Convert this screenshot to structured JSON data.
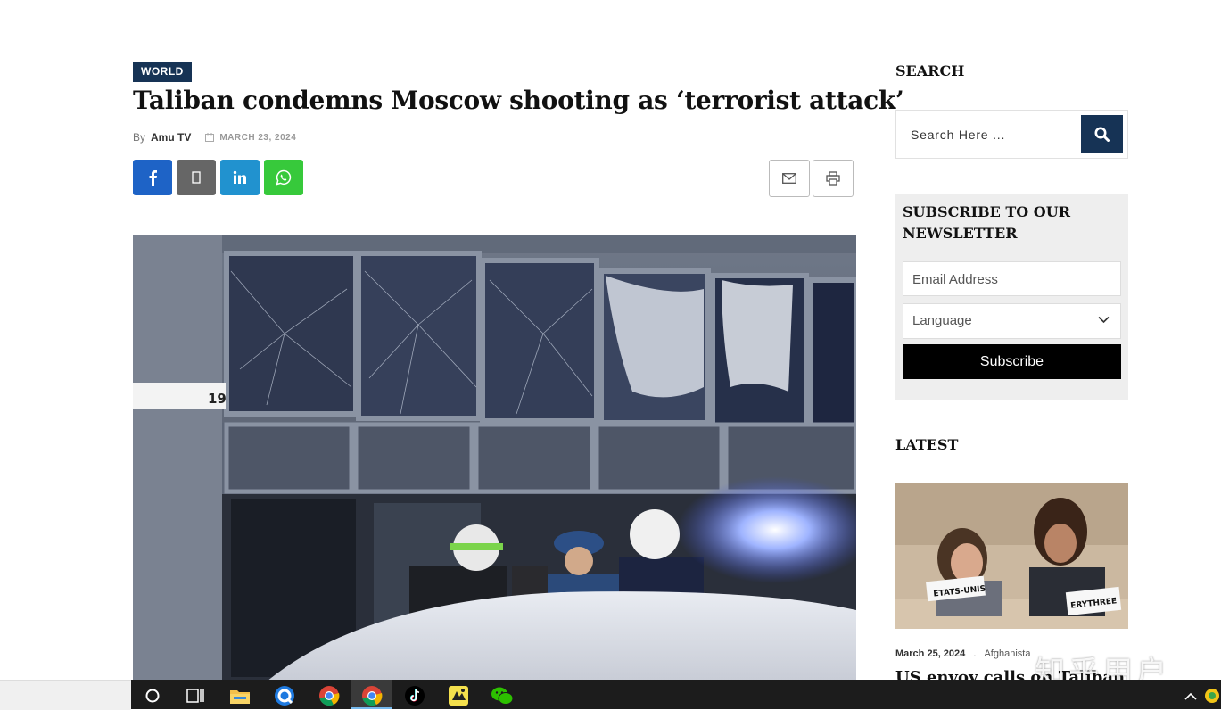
{
  "article": {
    "category": "WORLD",
    "title": "Taliban condemns Moscow shooting as ‘terrorist attack’",
    "by_label": "By",
    "author": "Amu TV",
    "date": "MARCH 23, 2024",
    "share_buttons": [
      "facebook-icon",
      "x-icon",
      "linkedin-icon",
      "whatsapp-icon",
      "mail-icon",
      "print-icon"
    ],
    "hero_sign_number": "19"
  },
  "sidebar": {
    "search": {
      "heading": "SEARCH",
      "placeholder": "Search Here ..."
    },
    "newsletter": {
      "heading": "SUBSCRIBE TO OUR NEWSLETTER",
      "email_placeholder": "Email Address",
      "language_label": "Language",
      "subscribe_label": "Subscribe"
    },
    "latest": {
      "heading": "LATEST",
      "item": {
        "date": "March 25, 2024",
        "separator": ".",
        "category": "Afghanista",
        "title": "US envoy calls on Taliban"
      }
    }
  },
  "overlay": {
    "watermark": "知乎用户"
  },
  "taskbar": {
    "icons": [
      "cortana-search-icon",
      "task-view-icon",
      "file-explorer-icon",
      "browser-q-icon",
      "chrome-icon",
      "chrome-icon-active",
      "tiktok-icon",
      "app-icon",
      "wechat-icon"
    ],
    "tray": [
      "chevron-up-icon",
      "status-icon"
    ]
  },
  "colors": {
    "category_bg": "#163355",
    "search_button": "#163355",
    "facebook": "#1e63c6",
    "twitter": "#666666",
    "linkedin": "#2192cf",
    "whatsapp": "#37c93b",
    "newsletter_bg": "#eeeeee",
    "subscribe_bg": "#000000"
  }
}
